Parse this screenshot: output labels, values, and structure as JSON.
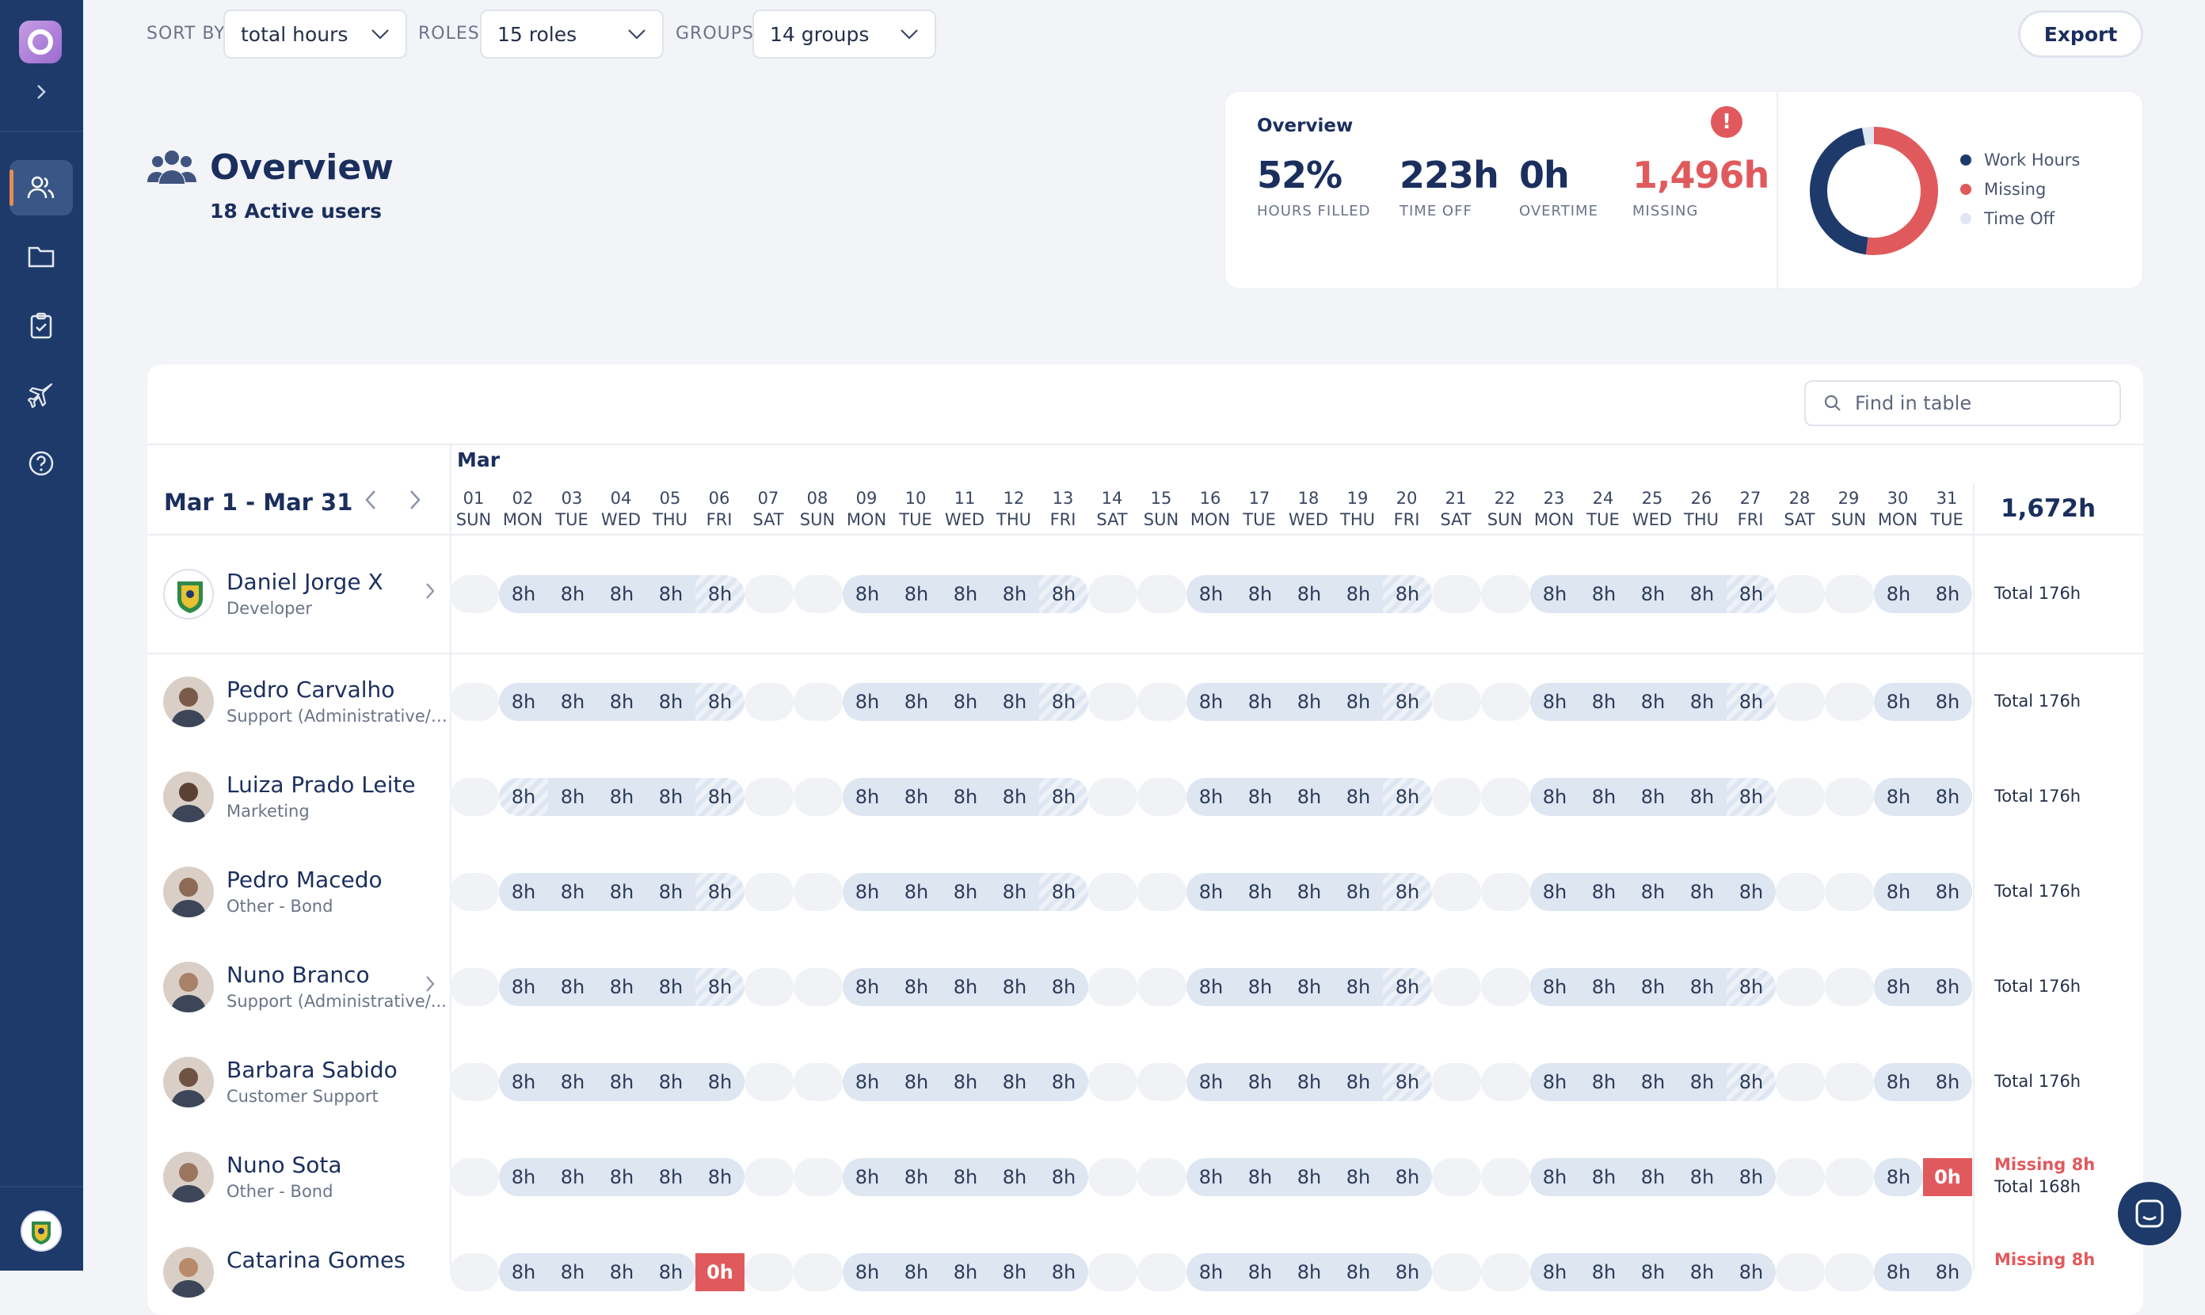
{
  "filters": {
    "sort_label": "SORT BY",
    "sort_value": "total hours",
    "roles_label": "ROLES",
    "roles_value": "15 roles",
    "groups_label": "GROUPS",
    "groups_value": "14 groups",
    "export_label": "Export"
  },
  "overview": {
    "title": "Overview",
    "subtitle": "18 Active users"
  },
  "summary": {
    "title": "Overview",
    "alert_icon": "!",
    "stats": [
      {
        "value": "52%",
        "label": "HOURS FILLED"
      },
      {
        "value": "223h",
        "label": "TIME OFF"
      },
      {
        "value": "0h",
        "label": "OVERTIME"
      },
      {
        "value": "1,496h",
        "label": "MISSING"
      }
    ],
    "legend": [
      "Work Hours",
      "Missing",
      "Time Off"
    ],
    "donut": {
      "work": 0.45,
      "missing": 0.52,
      "time_off": 0.03
    },
    "colors": {
      "work": "#1e3a6b",
      "missing": "#e05a5d",
      "time_off": "#dfe7f2"
    }
  },
  "table": {
    "search_placeholder": "Find in table",
    "month": "Mar",
    "range": "Mar 1 - Mar 31",
    "grand_total": "1,672h",
    "days": [
      [
        "01",
        "SUN"
      ],
      [
        "02",
        "MON"
      ],
      [
        "03",
        "TUE"
      ],
      [
        "04",
        "WED"
      ],
      [
        "05",
        "THU"
      ],
      [
        "06",
        "FRI"
      ],
      [
        "07",
        "SAT"
      ],
      [
        "08",
        "SUN"
      ],
      [
        "09",
        "MON"
      ],
      [
        "10",
        "TUE"
      ],
      [
        "11",
        "WED"
      ],
      [
        "12",
        "THU"
      ],
      [
        "13",
        "FRI"
      ],
      [
        "14",
        "SAT"
      ],
      [
        "15",
        "SUN"
      ],
      [
        "16",
        "MON"
      ],
      [
        "17",
        "TUE"
      ],
      [
        "18",
        "WED"
      ],
      [
        "19",
        "THU"
      ],
      [
        "20",
        "FRI"
      ],
      [
        "21",
        "SAT"
      ],
      [
        "22",
        "SUN"
      ],
      [
        "23",
        "MON"
      ],
      [
        "24",
        "TUE"
      ],
      [
        "25",
        "WED"
      ],
      [
        "26",
        "THU"
      ],
      [
        "27",
        "FRI"
      ],
      [
        "28",
        "SAT"
      ],
      [
        "29",
        "SUN"
      ],
      [
        "30",
        "MON"
      ],
      [
        "31",
        "TUE"
      ]
    ],
    "users": [
      {
        "name": "Daniel Jorge X",
        "role": "Developer",
        "total": "Total 176h",
        "missing": "",
        "avatar": "crest"
      },
      {
        "name": "Pedro Carvalho",
        "role": "Support (Administrative/Fina...",
        "total": "Total 176h",
        "missing": "",
        "avatar": "photo"
      },
      {
        "name": "Luiza Prado Leite",
        "role": "Marketing",
        "total": "Total 176h",
        "missing": "",
        "avatar": "photo"
      },
      {
        "name": "Pedro Macedo",
        "role": "Other - Bond",
        "total": "Total 176h",
        "missing": "",
        "avatar": "photo"
      },
      {
        "name": "Nuno Branco",
        "role": "Support (Administrative/...",
        "total": "Total 176h",
        "missing": "",
        "avatar": "photo"
      },
      {
        "name": "Barbara Sabido",
        "role": "Customer Support",
        "total": "Total 176h",
        "missing": "",
        "avatar": "photo"
      },
      {
        "name": "Nuno Sota",
        "role": "Other - Bond",
        "total": "Total 168h",
        "missing": "Missing 8h",
        "avatar": "photo"
      },
      {
        "name": "Catarina Gomes",
        "role": "",
        "total": "",
        "missing": "Missing 8h",
        "avatar": "photo"
      }
    ],
    "cell_value": "8h",
    "missing_value": "0h"
  },
  "icons": [
    "people-icon",
    "folder-icon",
    "clipboard-check-icon",
    "plane-icon",
    "help-icon",
    "chevron-right-icon",
    "chevron-down-icon",
    "search-icon",
    "chat-icon"
  ]
}
